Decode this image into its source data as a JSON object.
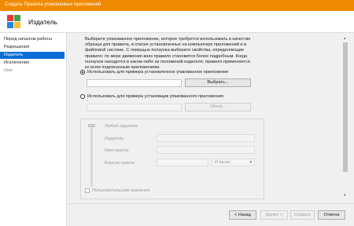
{
  "window": {
    "title": "Создать Правила упакованных приложений"
  },
  "header": {
    "title": "Издатель"
  },
  "nav": [
    {
      "label": "Перед началом работы",
      "state": "normal"
    },
    {
      "label": "Разрешения",
      "state": "normal"
    },
    {
      "label": "Издатель",
      "state": "selected"
    },
    {
      "label": "Исключения",
      "state": "normal"
    },
    {
      "label": "Имя",
      "state": "dim"
    }
  ],
  "description": "Выберите упакованное приложение, которое требуется использовать в качестве образца для правила, в списке установленных на компьютере приложений и в файловой системе. С помощью ползунка выберите свойства, определяющие правило: по мере движения вниз правило становится более подробным. Когда ползунок находится в каком-либо из положений издателя, правило применяется ко всем подписанным приложениям.",
  "options": {
    "installed": {
      "label": "Использовать для примера установленное упакованное приложение",
      "selected": true,
      "button": "Выбрать..."
    },
    "installer": {
      "label": "Использовать для примера установщик упакованного приложения",
      "selected": false,
      "button": "Обзор..."
    }
  },
  "group": {
    "slider_label": "Любой издатель",
    "rows": [
      {
        "label": "Издатель:",
        "value": ""
      },
      {
        "label": "Имя пакета:",
        "value": ""
      },
      {
        "label": "Версия пакета:",
        "value": ""
      }
    ],
    "version_select": "И выше",
    "custom_values": "Пользовательские значения"
  },
  "footer": {
    "back": "< Назад",
    "next": "Далее >",
    "create": "Создать",
    "cancel": "Отмена"
  },
  "colors": {
    "titlebar": "#f08a00",
    "selection": "#0a6cd6"
  },
  "icons": {
    "app": "app-grid-icon",
    "chevron": "chevron-down-icon"
  }
}
